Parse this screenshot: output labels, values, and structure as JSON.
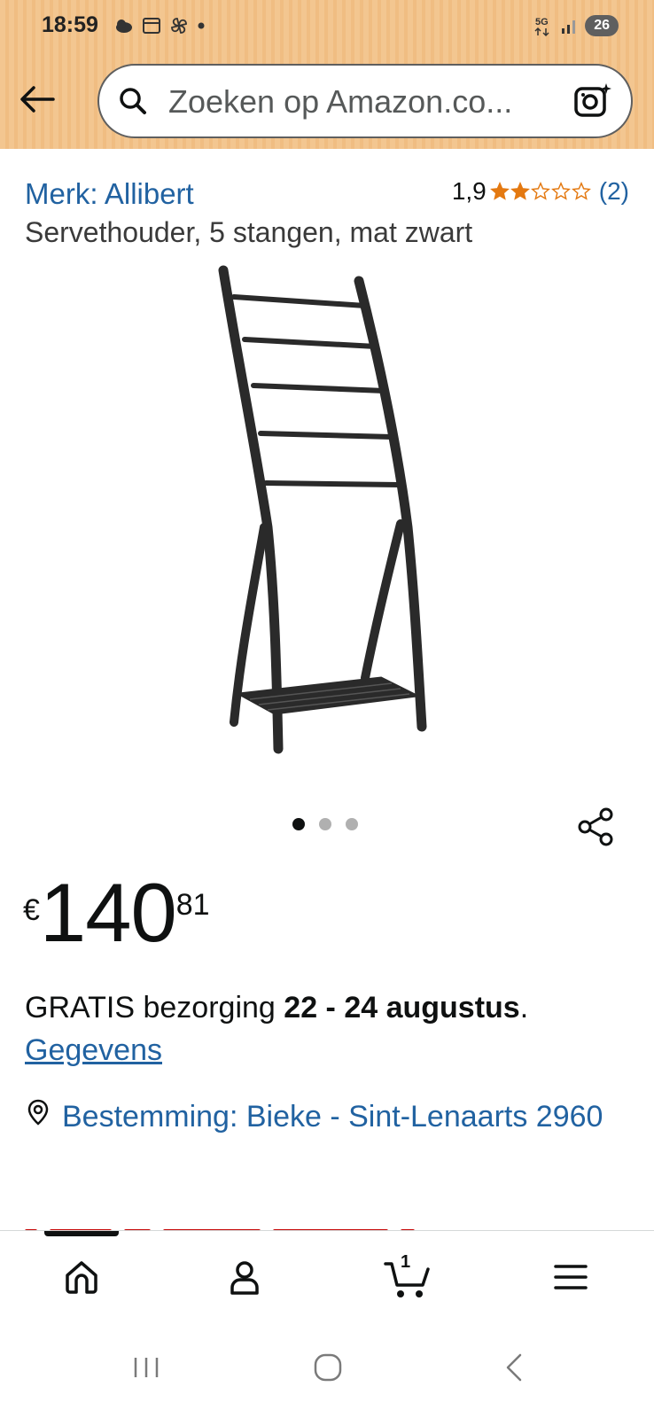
{
  "status_bar": {
    "time": "18:59",
    "network": "5G",
    "battery": "26"
  },
  "search": {
    "placeholder": "Zoeken op Amazon.co..."
  },
  "product": {
    "brand": "Merk: Allibert",
    "rating_value": "1,9",
    "rating_stars": 2,
    "rating_count": "(2)",
    "title": "Servethouder, 5 stangen, mat zwart",
    "image_count": 3,
    "active_image": 1
  },
  "price": {
    "symbol": "€",
    "whole": "140",
    "fraction": "81"
  },
  "delivery": {
    "prefix": "GRATIS bezorging ",
    "dates": "22 - 24 augustus",
    "suffix": ".",
    "details_link": "Gegevens",
    "location": "Bestemming: Bieke - Sint-Lenaarts 2960"
  },
  "bottom_nav": {
    "items": [
      "home",
      "account",
      "cart",
      "menu"
    ],
    "cart_count": "1",
    "active": "home"
  },
  "colors": {
    "header_bg": "#f3c690",
    "link": "#2162a1",
    "star": "#e47911",
    "text": "#0f1111"
  }
}
